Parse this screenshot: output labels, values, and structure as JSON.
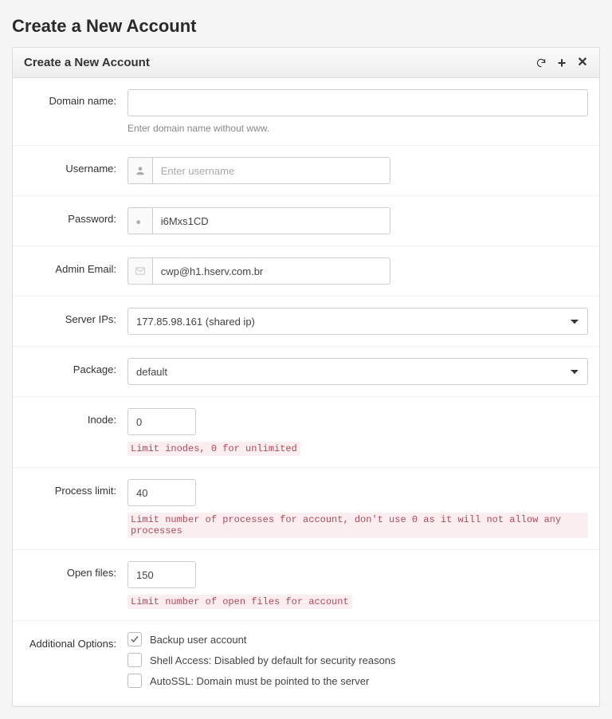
{
  "page_title": "Create a New Account",
  "panel": {
    "title": "Create a New Account"
  },
  "labels": {
    "domain": "Domain name:",
    "username": "Username:",
    "password": "Password:",
    "admin_email": "Admin Email:",
    "server_ips": "Server IPs:",
    "package": "Package:",
    "inode": "Inode:",
    "process_limit": "Process limit:",
    "open_files": "Open files:",
    "additional_options": "Additional Options:"
  },
  "fields": {
    "domain": {
      "value": "",
      "hint": "Enter domain name without www."
    },
    "username": {
      "value": "",
      "placeholder": "Enter username"
    },
    "password": {
      "value": "i6Mxs1CD"
    },
    "admin_email": {
      "value": "cwp@h1.hserv.com.br"
    },
    "server_ips": {
      "selected": "177.85.98.161 (shared ip)"
    },
    "package": {
      "selected": "default"
    },
    "inode": {
      "value": "0",
      "hint": "Limit inodes, 0 for unlimited"
    },
    "process_limit": {
      "value": "40",
      "hint": "Limit number of processes for account, don't use 0 as it will not allow any processes"
    },
    "open_files": {
      "value": "150",
      "hint": "Limit number of open files for account"
    }
  },
  "options": {
    "backup": {
      "label": "Backup user account",
      "checked": true
    },
    "shell": {
      "label": "Shell Access: Disabled by default for security reasons",
      "checked": false
    },
    "autossl": {
      "label": "AutoSSL: Domain must be pointed to the server",
      "checked": false
    }
  }
}
